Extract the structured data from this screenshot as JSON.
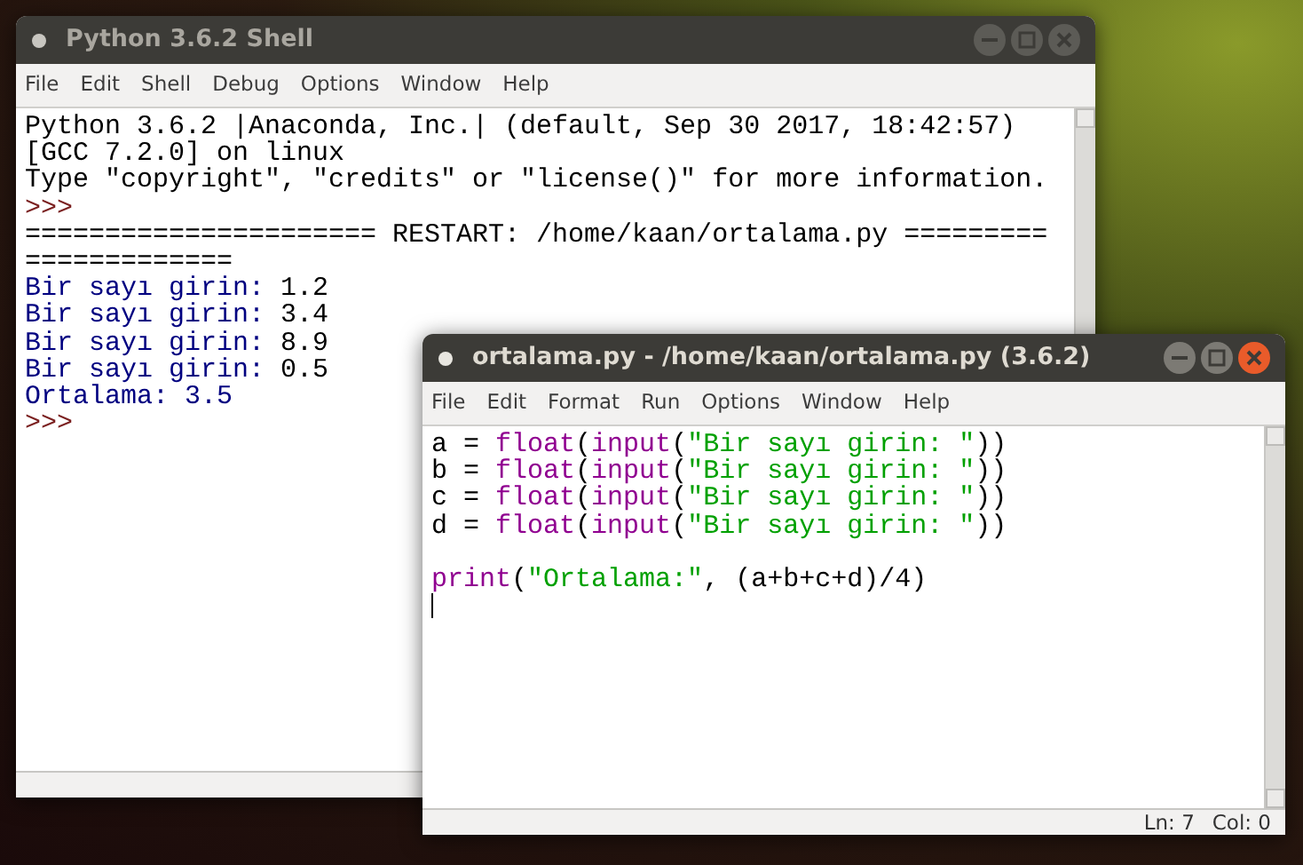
{
  "windows": [
    {
      "title": "Python 3.6.2 Shell",
      "active": false,
      "menu": [
        "File",
        "Edit",
        "Shell",
        "Debug",
        "Options",
        "Window",
        "Help"
      ],
      "lines": [
        {
          "tokens": [
            {
              "kind": "plain",
              "text": "Python 3.6.2 |Anaconda, Inc.| (default, Sep 30 2017, 18:42:57)"
            }
          ]
        },
        {
          "tokens": [
            {
              "kind": "plain",
              "text": "[GCC 7.2.0] on linux"
            }
          ]
        },
        {
          "tokens": [
            {
              "kind": "plain",
              "text": "Type \"copyright\", \"credits\" or \"license()\" for more information."
            }
          ]
        },
        {
          "tokens": [
            {
              "kind": "prompt",
              "text": ">>>"
            }
          ]
        },
        {
          "tokens": [
            {
              "kind": "plain",
              "text": "====================== RESTART: /home/kaan/ortalama.py ========="
            }
          ]
        },
        {
          "tokens": [
            {
              "kind": "plain",
              "text": "============="
            }
          ]
        },
        {
          "tokens": [
            {
              "kind": "stdout",
              "text": "Bir sayı girin: "
            },
            {
              "kind": "plain",
              "text": "1.2"
            }
          ]
        },
        {
          "tokens": [
            {
              "kind": "stdout",
              "text": "Bir sayı girin: "
            },
            {
              "kind": "plain",
              "text": "3.4"
            }
          ]
        },
        {
          "tokens": [
            {
              "kind": "stdout",
              "text": "Bir sayı girin: "
            },
            {
              "kind": "plain",
              "text": "8.9"
            }
          ]
        },
        {
          "tokens": [
            {
              "kind": "stdout",
              "text": "Bir sayı girin: "
            },
            {
              "kind": "plain",
              "text": "0.5"
            }
          ]
        },
        {
          "tokens": [
            {
              "kind": "stdout",
              "text": "Ortalama: 3.5"
            }
          ]
        },
        {
          "tokens": [
            {
              "kind": "prompt",
              "text": ">>>"
            }
          ]
        }
      ]
    },
    {
      "title": "ortalama.py - /home/kaan/ortalama.py (3.6.2)",
      "active": true,
      "menu": [
        "File",
        "Edit",
        "Format",
        "Run",
        "Options",
        "Window",
        "Help"
      ],
      "lines": [
        {
          "tokens": [
            {
              "kind": "plain",
              "text": "a = "
            },
            {
              "kind": "builtin",
              "text": "float"
            },
            {
              "kind": "plain",
              "text": "("
            },
            {
              "kind": "builtin",
              "text": "input"
            },
            {
              "kind": "plain",
              "text": "("
            },
            {
              "kind": "string",
              "text": "\"Bir sayı girin: \""
            },
            {
              "kind": "plain",
              "text": "))"
            }
          ]
        },
        {
          "tokens": [
            {
              "kind": "plain",
              "text": "b = "
            },
            {
              "kind": "builtin",
              "text": "float"
            },
            {
              "kind": "plain",
              "text": "("
            },
            {
              "kind": "builtin",
              "text": "input"
            },
            {
              "kind": "plain",
              "text": "("
            },
            {
              "kind": "string",
              "text": "\"Bir sayı girin: \""
            },
            {
              "kind": "plain",
              "text": "))"
            }
          ]
        },
        {
          "tokens": [
            {
              "kind": "plain",
              "text": "c = "
            },
            {
              "kind": "builtin",
              "text": "float"
            },
            {
              "kind": "plain",
              "text": "("
            },
            {
              "kind": "builtin",
              "text": "input"
            },
            {
              "kind": "plain",
              "text": "("
            },
            {
              "kind": "string",
              "text": "\"Bir sayı girin: \""
            },
            {
              "kind": "plain",
              "text": "))"
            }
          ]
        },
        {
          "tokens": [
            {
              "kind": "plain",
              "text": "d = "
            },
            {
              "kind": "builtin",
              "text": "float"
            },
            {
              "kind": "plain",
              "text": "("
            },
            {
              "kind": "builtin",
              "text": "input"
            },
            {
              "kind": "plain",
              "text": "("
            },
            {
              "kind": "string",
              "text": "\"Bir sayı girin: \""
            },
            {
              "kind": "plain",
              "text": "))"
            }
          ]
        },
        {
          "kind": "blank"
        },
        {
          "tokens": [
            {
              "kind": "builtin",
              "text": "print"
            },
            {
              "kind": "plain",
              "text": "("
            },
            {
              "kind": "string",
              "text": "\"Ortalama:\""
            },
            {
              "kind": "plain",
              "text": ", (a+b+c+d)/4)"
            }
          ]
        },
        {
          "kind": "cursor"
        }
      ],
      "status": [
        "Ln: 7",
        "Col: 0"
      ]
    }
  ]
}
